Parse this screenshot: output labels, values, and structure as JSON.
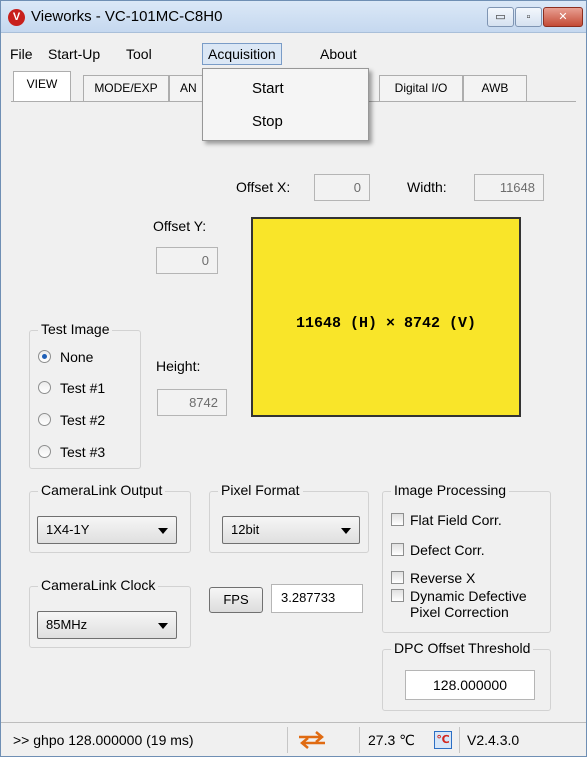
{
  "window": {
    "title": "Vieworks - VC-101MC-C8H0",
    "app_icon": "V"
  },
  "window_controls": {
    "minimize": "▭",
    "maximize": "▫",
    "close": "✕"
  },
  "menubar": [
    {
      "label": "File"
    },
    {
      "label": "Start-Up"
    },
    {
      "label": "Tool"
    },
    {
      "label": "Acquisition",
      "active": true
    },
    {
      "label": "About"
    }
  ],
  "dropdown": {
    "items": [
      "Start",
      "Stop"
    ]
  },
  "tabs": [
    "VIEW",
    "MODE/EXP",
    "AN",
    "Digital I/O",
    "AWB"
  ],
  "view": {
    "offset_x_label": "Offset X:",
    "offset_x_value": "0",
    "width_label": "Width:",
    "width_value": "11648",
    "offset_y_label": "Offset Y:",
    "offset_y_value": "0",
    "height_label": "Height:",
    "height_value": "8742",
    "preview_text": "11648 (H) × 8742 (V)",
    "preview_color": "#f9e529"
  },
  "test_image": {
    "title": "Test Image",
    "options": [
      "None",
      "Test #1",
      "Test #2",
      "Test #3"
    ],
    "selected": "None"
  },
  "cameralink_output": {
    "title": "CameraLink Output",
    "value": "1X4-1Y"
  },
  "pixel_format": {
    "title": "Pixel Format",
    "value": "12bit"
  },
  "cameralink_clock": {
    "title": "CameraLink Clock",
    "value": "85MHz"
  },
  "fps": {
    "button": "FPS",
    "value": "3.287733"
  },
  "image_processing": {
    "title": "Image Processing",
    "options": [
      "Flat Field Corr.",
      "Defect Corr.",
      "Reverse X",
      "Dynamic Defective",
      "Pixel Correction"
    ]
  },
  "dpc": {
    "title": "DPC Offset Threshold",
    "value": "128.000000"
  },
  "statusbar": {
    "command": ">> ghpo  128.000000  (19 ms)",
    "temperature": "27.3 ℃",
    "version": "V2.4.3.0",
    "swap_icon": "swap-arrows-icon",
    "temp_icon": "temperature-icon"
  }
}
